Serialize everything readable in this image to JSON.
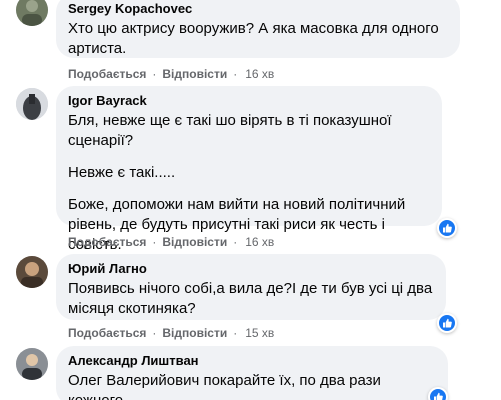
{
  "actions": {
    "like_label": "Подобається",
    "reply_label": "Відповісти"
  },
  "colors": {
    "bubble": "#f0f2f5",
    "meta": "#65676b",
    "like_blue": "#1877f2"
  },
  "comments": [
    {
      "author": "Sergey Kopachovec",
      "paragraphs": [
        "Хто цю актрису вооружив? А яка масовка для одного\nартиста."
      ],
      "time": "16 хв",
      "reaction": ""
    },
    {
      "author": "Igor Bayrack",
      "paragraphs": [
        "Бля, невже ще є такі шо вірять в ті показушної\nсценарії?",
        "Невже є такі.....",
        "Боже, допоможи нам вийти на новий політичний\nрівень, де будуть присутні такі риси як честь і совість."
      ],
      "time": "16 хв",
      "reaction": "like-icon"
    },
    {
      "author": "Юрий Лагно",
      "paragraphs": [
        "Появивсь нічого собі,а вила де?І де ти був усі ці два\nмісяця скотиняка?"
      ],
      "time": "15 хв",
      "reaction": "like-icon"
    },
    {
      "author": "Александр Лиштван",
      "paragraphs": [
        "Олег Валерийович покарайте їх, по два рази кожного"
      ],
      "time": "",
      "reaction": "like-icon"
    }
  ]
}
